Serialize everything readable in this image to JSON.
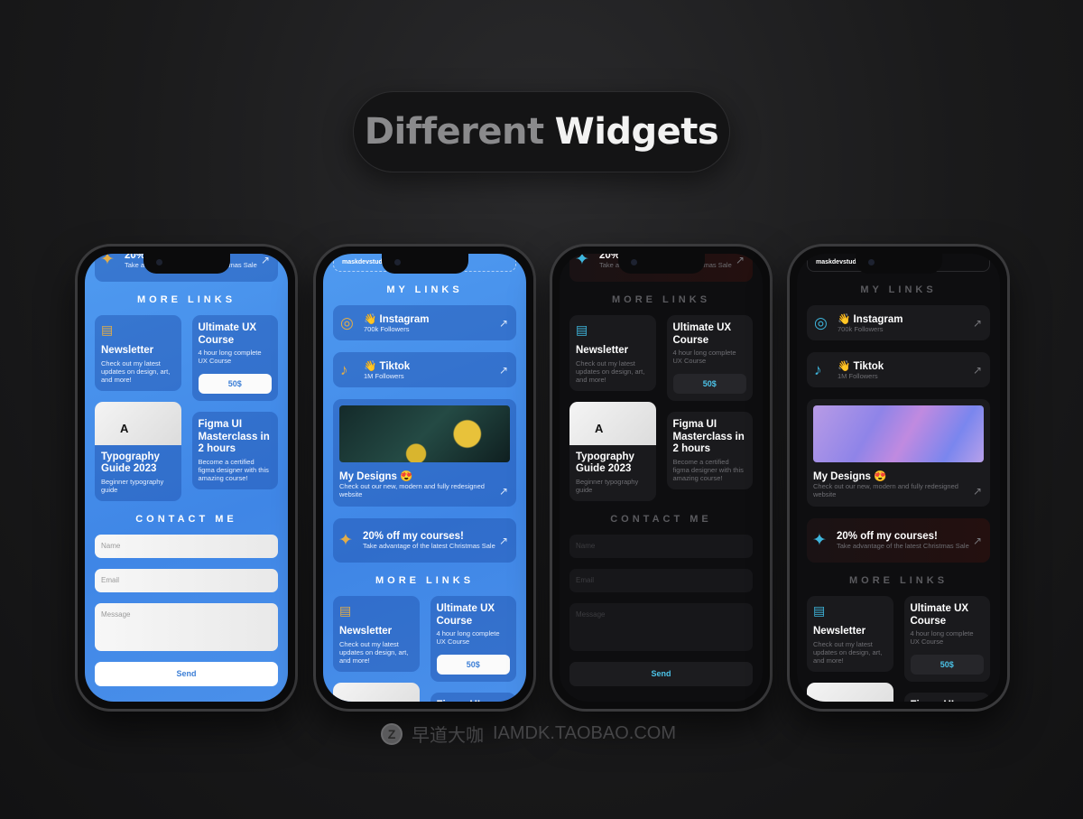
{
  "heading": {
    "part1": "Different",
    "part2": "Widgets"
  },
  "watermark": {
    "logo": "Z",
    "cn": "早道大咖",
    "url": "IAMDK.TAOBAO.COM"
  },
  "colors": {
    "blue_bg": "#4a90ea",
    "accent_gold": "#e3ad48",
    "accent_cyan": "#3eb5dc",
    "dark_bg": "#0e0e10"
  },
  "content": {
    "username": "maskdevstudio",
    "my_links": "MY LINKS",
    "more_links": "MORE LINKS",
    "contact_me": "CONTACT ME",
    "instagram": {
      "icon": "instagram-icon",
      "emoji": "👋",
      "title": "Instagram",
      "sub": "700k Followers"
    },
    "tiktok": {
      "icon": "tiktok-icon",
      "emoji": "👋",
      "title": "Tiktok",
      "sub": "1M Followers"
    },
    "designs": {
      "title": "My Designs 😍",
      "sub": "Check out our new, modern and fully redesigned website"
    },
    "promo": {
      "icon": "sparkle-icon",
      "title": "20% off my courses!",
      "sub": "Take advantage of the latest Christmas Sale"
    },
    "newsletter": {
      "icon": "newspaper-icon",
      "title": "Newsletter",
      "sub": "Check out my latest updates on design, art, and more!"
    },
    "course": {
      "title": "Ultimate UX Course",
      "sub": "4 hour long complete UX Course",
      "price": "50$"
    },
    "typography": {
      "title": "Typography Guide 2023",
      "sub": "Beginner typography guide"
    },
    "figma": {
      "title": "Figma UI Masterclass in 2 hours",
      "sub": "Become a certified figma designer with this amazing course!"
    },
    "form": {
      "name": "Name",
      "email": "Email",
      "message": "Message",
      "send": "Send"
    }
  },
  "phones": [
    {
      "theme": "blue",
      "layout": "more-links-contact"
    },
    {
      "theme": "blue",
      "layout": "my-links"
    },
    {
      "theme": "dark",
      "layout": "more-links-contact"
    },
    {
      "theme": "dark",
      "layout": "my-links"
    }
  ]
}
